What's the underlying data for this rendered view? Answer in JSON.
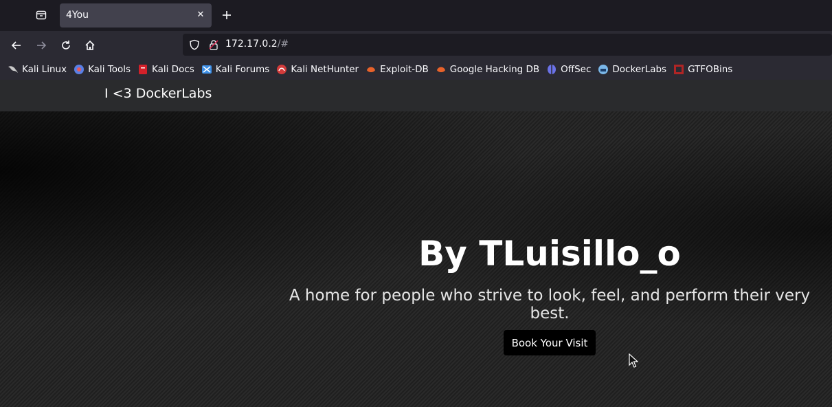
{
  "browser": {
    "tab": {
      "title": "4You"
    },
    "url": {
      "host": "172.17.0.2",
      "path": "/#"
    },
    "bookmarks": [
      {
        "label": "Kali Linux",
        "icon": "kali-dragon-icon",
        "color": "#c9c9c9"
      },
      {
        "label": "Kali Tools",
        "icon": "kali-tools-icon",
        "color": "#5a7fe6"
      },
      {
        "label": "Kali Docs",
        "icon": "kali-docs-icon",
        "color": "#d3202a"
      },
      {
        "label": "Kali Forums",
        "icon": "kali-forums-icon",
        "color": "#3d8fe8"
      },
      {
        "label": "Kali NetHunter",
        "icon": "nethunter-icon",
        "color": "#d33b3b"
      },
      {
        "label": "Exploit-DB",
        "icon": "exploit-db-icon",
        "color": "#e8622a"
      },
      {
        "label": "Google Hacking DB",
        "icon": "ghdb-icon",
        "color": "#e8622a"
      },
      {
        "label": "OffSec",
        "icon": "offsec-icon",
        "color": "#6b72e8"
      },
      {
        "label": "DockerLabs",
        "icon": "dockerlabs-icon",
        "color": "#7ab6e8"
      },
      {
        "label": "GTFOBins",
        "icon": "gtfobins-icon",
        "color": "#b02525"
      }
    ]
  },
  "page": {
    "brand": "I <3 DockerLabs",
    "hero": {
      "title": "By TLuisillo_o",
      "subtitle": "A home for people who strive to look, feel, and perform their very best.",
      "button": "Book Your Visit"
    }
  }
}
